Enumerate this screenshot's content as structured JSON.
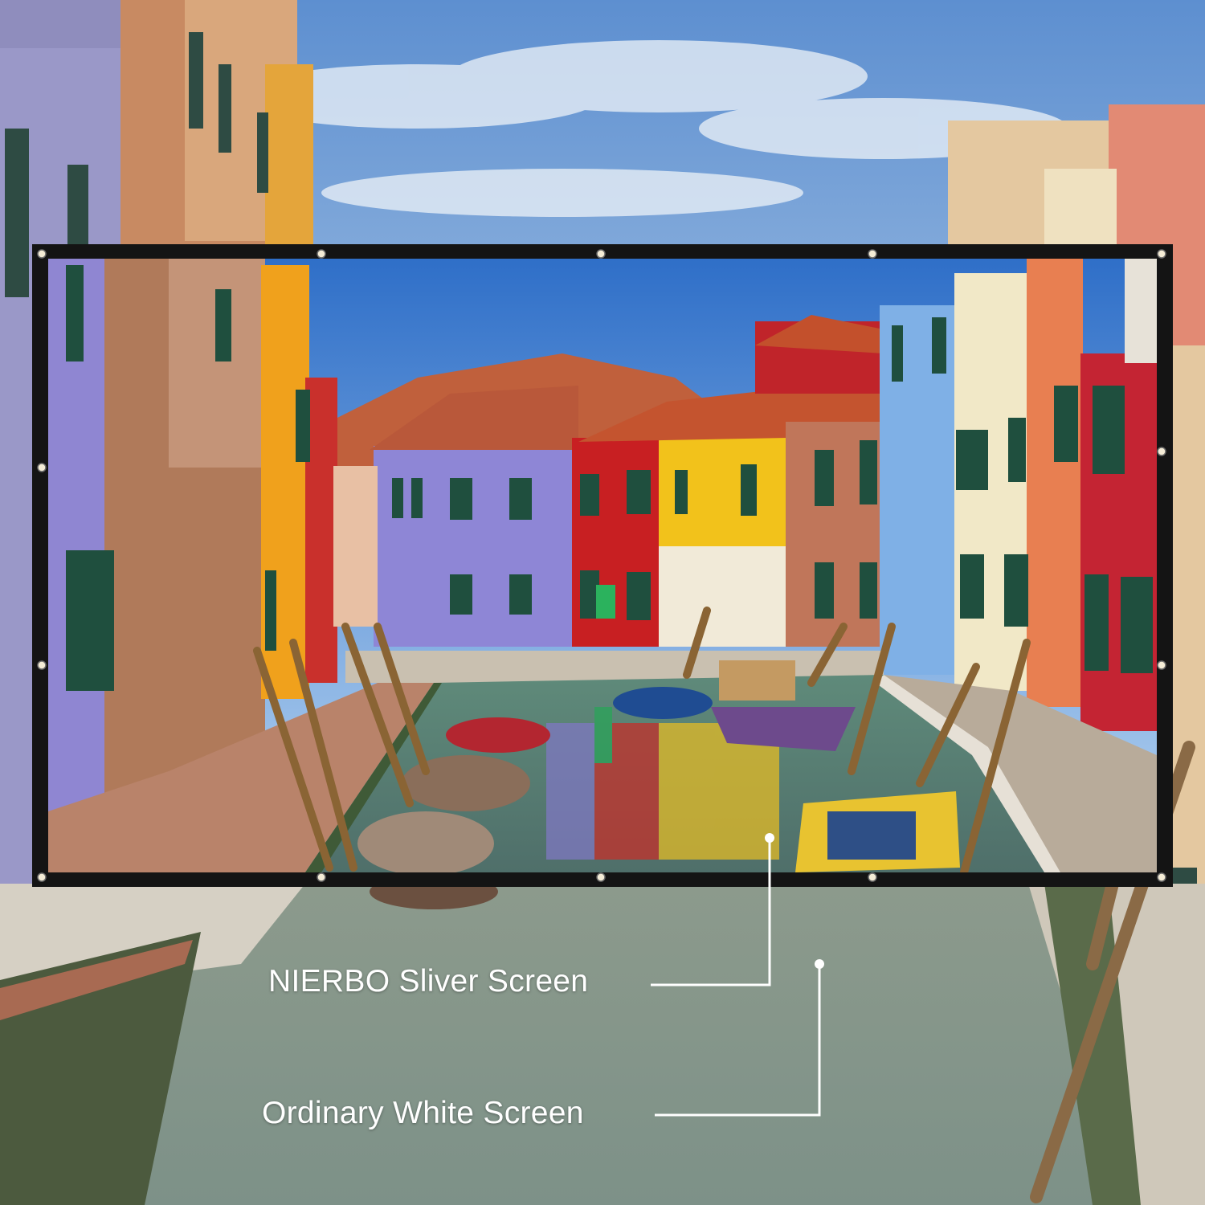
{
  "callouts": {
    "silver_screen_label": "NIERBO Sliver Screen",
    "white_screen_label": "Ordinary White Screen"
  },
  "colors": {
    "sky_top": "#3f78c4",
    "sky_bottom": "#cfe0ee",
    "screen_frame": "#141414",
    "grommet": "#f4ecd6",
    "callout_line": "#ffffff",
    "canal_water": "#8f9a86"
  }
}
